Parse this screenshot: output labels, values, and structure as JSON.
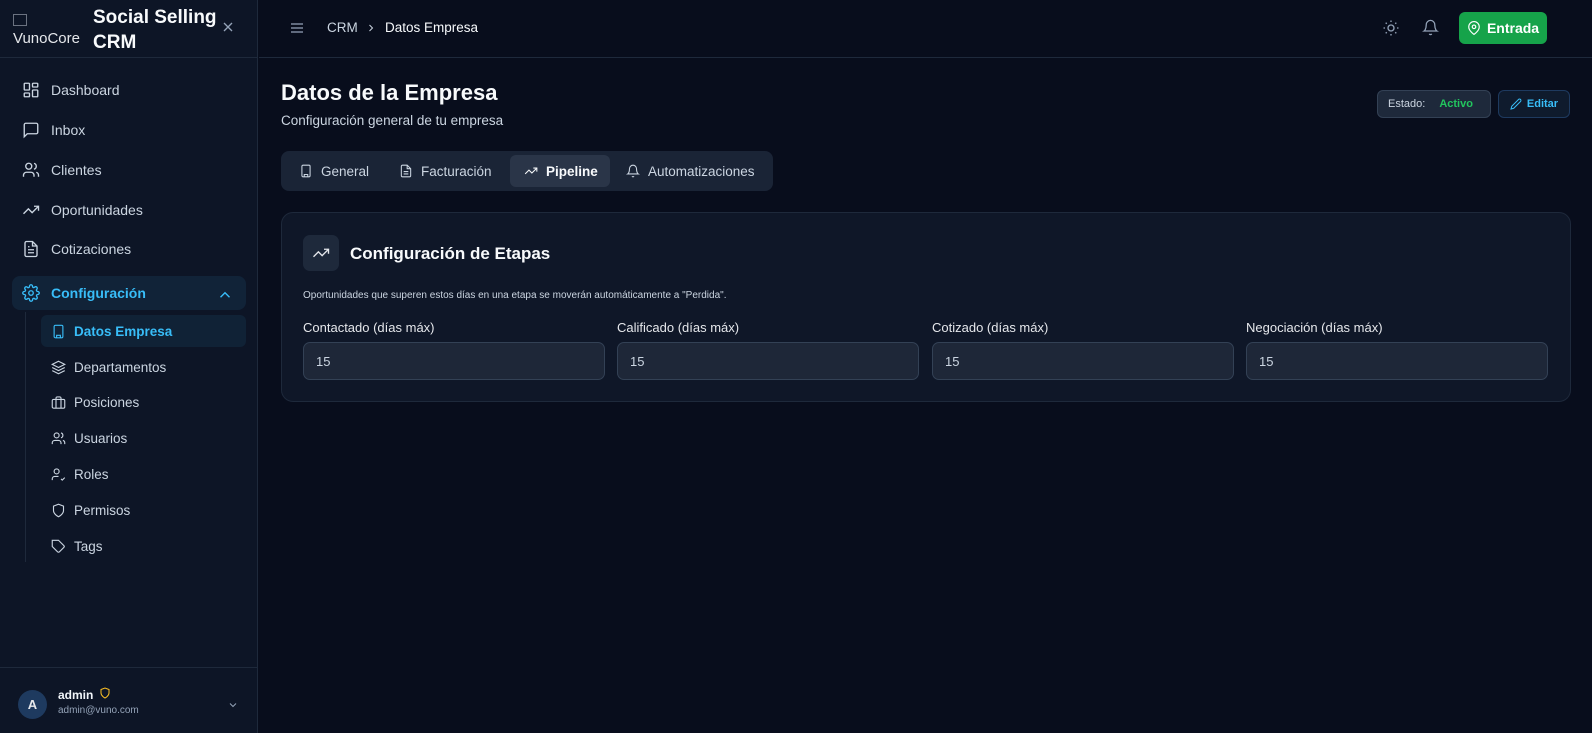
{
  "brand": {
    "logo_alt": "VunoCore",
    "title": "Social Selling CRM"
  },
  "sidebar": {
    "items": [
      {
        "label": "Dashboard",
        "icon": "dashboard-icon"
      },
      {
        "label": "Inbox",
        "icon": "inbox-icon"
      },
      {
        "label": "Clientes",
        "icon": "users-icon"
      },
      {
        "label": "Oportunidades",
        "icon": "trending-icon"
      },
      {
        "label": "Cotizaciones",
        "icon": "file-icon"
      }
    ],
    "config": {
      "label": "Configuración",
      "subitems": [
        {
          "label": "Datos Empresa"
        },
        {
          "label": "Departamentos"
        },
        {
          "label": "Posiciones"
        },
        {
          "label": "Usuarios"
        },
        {
          "label": "Roles"
        },
        {
          "label": "Permisos"
        },
        {
          "label": "Tags"
        }
      ]
    }
  },
  "user": {
    "avatar_letter": "A",
    "name": "admin",
    "email": "admin@vuno.com"
  },
  "header": {
    "crumb_root": "CRM",
    "crumb_current": "Datos Empresa",
    "entrada_label": "Entrada"
  },
  "page": {
    "title": "Datos de la Empresa",
    "subtitle": "Configuración general de tu empresa",
    "estado_label": "Estado:",
    "estado_value": "Activo",
    "edit_label": "Editar"
  },
  "tabs": [
    {
      "label": "General"
    },
    {
      "label": "Facturación"
    },
    {
      "label": "Pipeline"
    },
    {
      "label": "Automatizaciones"
    }
  ],
  "card": {
    "title": "Configuración de Etapas",
    "description": "Oportunidades que superen estos días en una etapa se moverán automáticamente a \"Perdida\".",
    "fields": [
      {
        "label": "Contactado (días máx)",
        "value": "15"
      },
      {
        "label": "Calificado (días máx)",
        "value": "15"
      },
      {
        "label": "Cotizado (días máx)",
        "value": "15"
      },
      {
        "label": "Negociación (días máx)",
        "value": "15"
      }
    ]
  },
  "colors": {
    "accent": "#38bdf8",
    "success": "#16a34a",
    "background": "#080d1c"
  }
}
